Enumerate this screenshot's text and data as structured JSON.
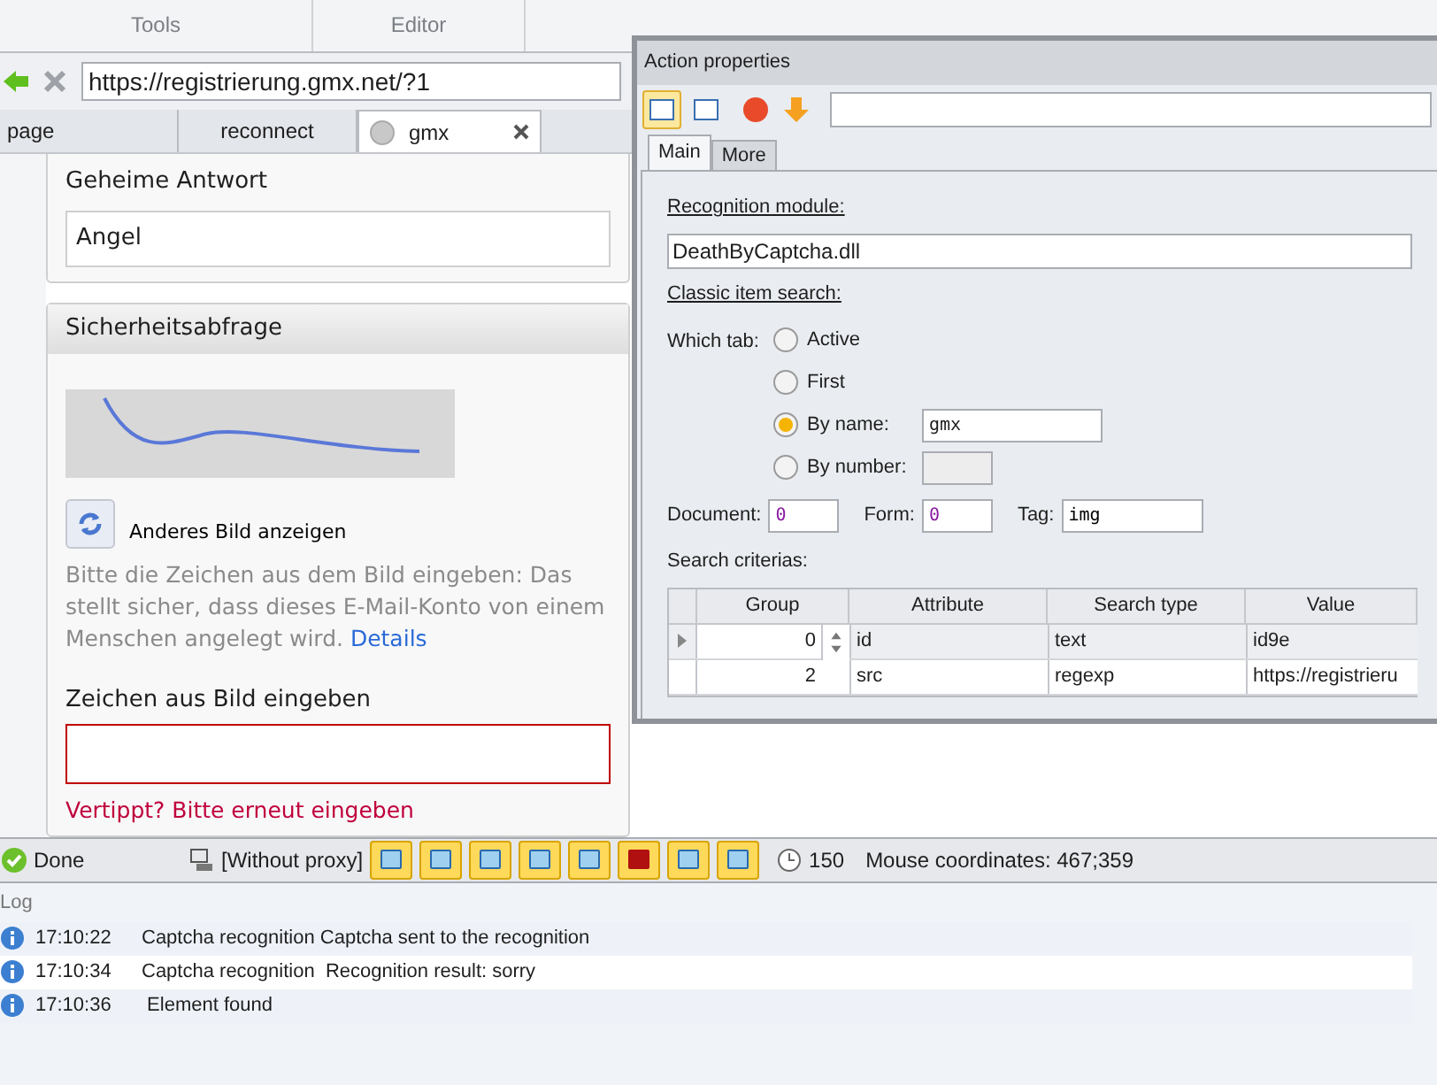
{
  "ribbon": {
    "groups": [
      "Tools",
      "Editor"
    ]
  },
  "address_bar": {
    "url": "https://registrierung.gmx.net/?1"
  },
  "browser_tabs": [
    {
      "label": "page",
      "selected": false
    },
    {
      "label": "reconnect",
      "selected": false
    },
    {
      "label": "gmx",
      "selected": true
    }
  ],
  "page": {
    "secret_answer": {
      "label": "Geheime Antwort",
      "value": "Angel"
    },
    "security_check": {
      "title": "Sicherheitsabfrage",
      "refresh_link": "Anderes Bild anzeigen",
      "description": "Bitte die Zeichen aus dem Bild eingeben: Das stellt sicher, dass dieses E-Mail-Konto von einem Menschen angelegt wird.",
      "details_link": "Details",
      "field_label": "Zeichen aus Bild eingeben",
      "error": "Vertippt? Bitte erneut eingeben"
    }
  },
  "action_properties": {
    "title": "Action properties",
    "view_buttons": [
      {
        "selected": true
      },
      {
        "selected": false
      }
    ],
    "tabs": [
      {
        "label": "Main",
        "selected": true
      },
      {
        "label": "More",
        "selected": false
      }
    ],
    "recognition_module_label": "Recognition module:",
    "recognition_module": "DeathByCaptcha.dll",
    "classic_item_search_label": "Classic item search:",
    "which_tab_label": "Which tab:",
    "which_tab_options": [
      {
        "label": "Active",
        "selected": false,
        "kind": "plain"
      },
      {
        "label": "First",
        "selected": false,
        "kind": "plain"
      },
      {
        "label": "By name:",
        "selected": true,
        "kind": "field",
        "value": "gmx"
      },
      {
        "label": "By number:",
        "selected": false,
        "kind": "field"
      }
    ],
    "document": {
      "label": "Document:",
      "value": "0"
    },
    "form": {
      "label": "Form:",
      "value": "0"
    },
    "tag": {
      "label": "Tag:",
      "value": "img"
    },
    "search_criteria_label": "Search criterias:",
    "grid_columns": [
      "Group",
      "Attribute",
      "Search type",
      "Value"
    ],
    "grid_rows": [
      {
        "group": "0",
        "attribute": "id",
        "search_type": "text",
        "value": "id9e",
        "selected": true
      },
      {
        "group": "2",
        "attribute": "src",
        "search_type": "regexp",
        "value": "https://registrieru",
        "selected": false
      }
    ]
  },
  "status_bar": {
    "status": "Done",
    "proxy": "[Without proxy]",
    "timer": "150",
    "mouse": "Mouse coordinates: 467;359"
  },
  "log": {
    "title": "Log",
    "entries": [
      {
        "time": "17:10:22",
        "message": "Captcha recognition Captcha sent to the recognition"
      },
      {
        "time": "17:10:34",
        "message": "Captcha recognition  Recognition result: sorry"
      },
      {
        "time": "17:10:36",
        "message": " Element found"
      }
    ]
  }
}
